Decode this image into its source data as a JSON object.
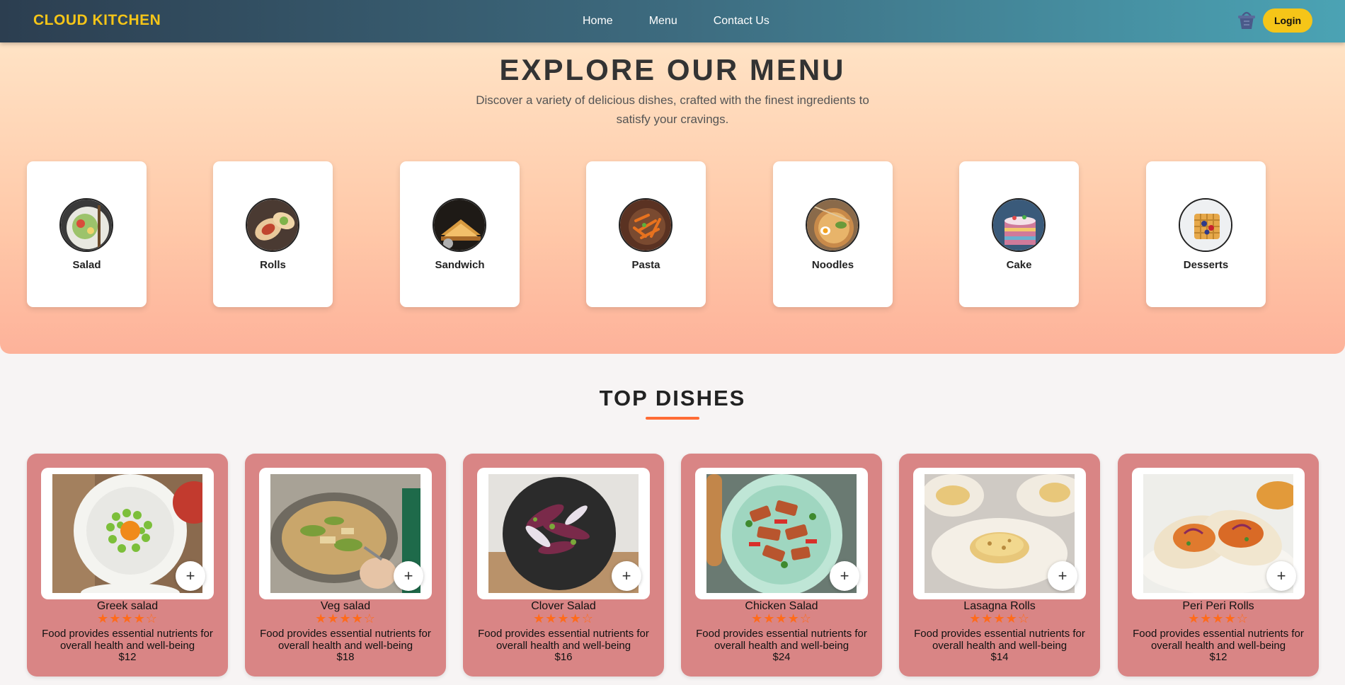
{
  "nav": {
    "brand": "CLOUD KITCHEN",
    "links": [
      "Home",
      "Menu",
      "Contact Us"
    ],
    "cart_icon": "basket-icon",
    "login_label": "Login"
  },
  "hero": {
    "title": "EXPLORE OUR MENU",
    "subtitle": "Discover a variety of delicious dishes, crafted with the finest ingredients to satisfy your cravings.",
    "categories": [
      {
        "label": "Salad"
      },
      {
        "label": "Rolls"
      },
      {
        "label": "Sandwich"
      },
      {
        "label": "Pasta"
      },
      {
        "label": "Noodles"
      },
      {
        "label": "Cake"
      },
      {
        "label": "Desserts"
      }
    ]
  },
  "top_dishes": {
    "title": "TOP DISHES",
    "items": [
      {
        "name": "Greek salad",
        "rating": 4,
        "rating_max": 5,
        "description": "Food provides essential nutrients for overall health and well-being",
        "price": "$12"
      },
      {
        "name": "Veg salad",
        "rating": 4,
        "rating_max": 5,
        "description": "Food provides essential nutrients for overall health and well-being",
        "price": "$18"
      },
      {
        "name": "Clover Salad",
        "rating": 4,
        "rating_max": 5,
        "description": "Food provides essential nutrients for overall health and well-being",
        "price": "$16"
      },
      {
        "name": "Chicken Salad",
        "rating": 4,
        "rating_max": 5,
        "description": "Food provides essential nutrients for overall health and well-being",
        "price": "$24"
      },
      {
        "name": "Lasagna Rolls",
        "rating": 4,
        "rating_max": 5,
        "description": "Food provides essential nutrients for overall health and well-being",
        "price": "$14"
      },
      {
        "name": "Peri Peri Rolls",
        "rating": 4,
        "rating_max": 5,
        "description": "Food provides essential nutrients for overall health and well-being",
        "price": "$12"
      }
    ],
    "add_label": "+"
  },
  "colors": {
    "brand_yellow": "#f5c518",
    "accent_orange": "#ff6b35",
    "dish_card": "#d98585"
  }
}
